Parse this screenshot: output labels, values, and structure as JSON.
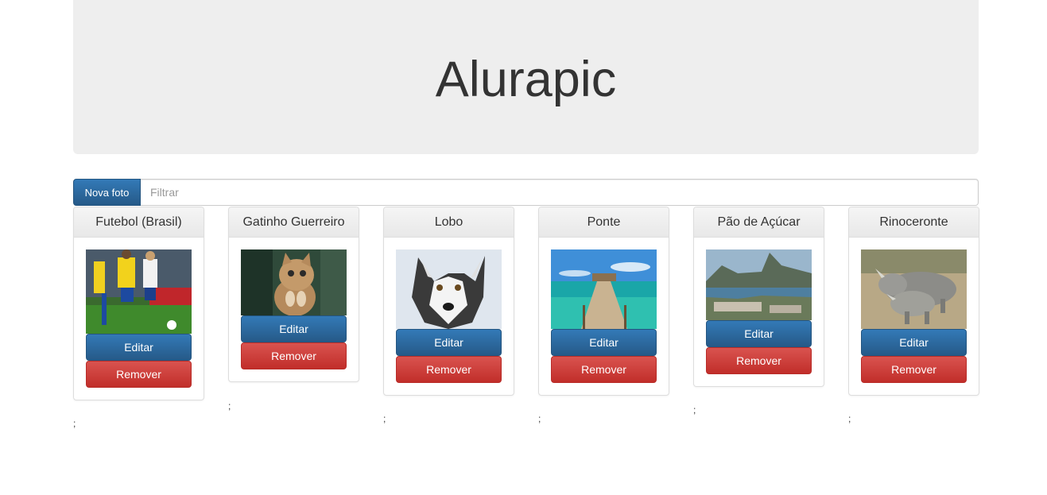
{
  "header": {
    "title": "Alurapic"
  },
  "toolbar": {
    "new_photo_label": "Nova foto",
    "filter_placeholder": "Filtrar",
    "filter_value": ""
  },
  "photos": [
    {
      "title": "Futebol (Brasil)",
      "image": "soccer-players-photo",
      "edit_label": "Editar",
      "remove_label": "Remover",
      "separator": ";"
    },
    {
      "title": "Gatinho Guerreiro",
      "image": "kitten-photo",
      "edit_label": "Editar",
      "remove_label": "Remover",
      "separator": ";"
    },
    {
      "title": "Lobo",
      "image": "husky-wolf-photo",
      "edit_label": "Editar",
      "remove_label": "Remover",
      "separator": ";"
    },
    {
      "title": "Ponte",
      "image": "pier-beach-photo",
      "edit_label": "Editar",
      "remove_label": "Remover",
      "separator": ";"
    },
    {
      "title": "Pão de Açúcar",
      "image": "sugarloaf-mountain-photo",
      "edit_label": "Editar",
      "remove_label": "Remover",
      "separator": ";"
    },
    {
      "title": "Rinoceronte",
      "image": "rhinoceros-photo",
      "edit_label": "Editar",
      "remove_label": "Remover",
      "separator": ";"
    }
  ],
  "colors": {
    "primary": "#337ab7",
    "danger": "#d9534f",
    "jumbotron_bg": "#eeeeee"
  }
}
